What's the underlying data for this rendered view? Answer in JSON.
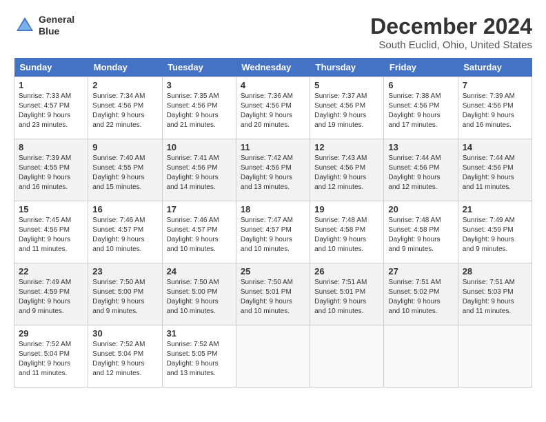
{
  "logo": {
    "line1": "General",
    "line2": "Blue"
  },
  "title": "December 2024",
  "subtitle": "South Euclid, Ohio, United States",
  "days_header": [
    "Sunday",
    "Monday",
    "Tuesday",
    "Wednesday",
    "Thursday",
    "Friday",
    "Saturday"
  ],
  "weeks": [
    [
      {
        "day": "1",
        "sunrise": "7:33 AM",
        "sunset": "4:57 PM",
        "daylight": "9 hours and 23 minutes."
      },
      {
        "day": "2",
        "sunrise": "7:34 AM",
        "sunset": "4:56 PM",
        "daylight": "9 hours and 22 minutes."
      },
      {
        "day": "3",
        "sunrise": "7:35 AM",
        "sunset": "4:56 PM",
        "daylight": "9 hours and 21 minutes."
      },
      {
        "day": "4",
        "sunrise": "7:36 AM",
        "sunset": "4:56 PM",
        "daylight": "9 hours and 20 minutes."
      },
      {
        "day": "5",
        "sunrise": "7:37 AM",
        "sunset": "4:56 PM",
        "daylight": "9 hours and 19 minutes."
      },
      {
        "day": "6",
        "sunrise": "7:38 AM",
        "sunset": "4:56 PM",
        "daylight": "9 hours and 17 minutes."
      },
      {
        "day": "7",
        "sunrise": "7:39 AM",
        "sunset": "4:56 PM",
        "daylight": "9 hours and 16 minutes."
      }
    ],
    [
      {
        "day": "8",
        "sunrise": "7:39 AM",
        "sunset": "4:55 PM",
        "daylight": "9 hours and 16 minutes."
      },
      {
        "day": "9",
        "sunrise": "7:40 AM",
        "sunset": "4:55 PM",
        "daylight": "9 hours and 15 minutes."
      },
      {
        "day": "10",
        "sunrise": "7:41 AM",
        "sunset": "4:56 PM",
        "daylight": "9 hours and 14 minutes."
      },
      {
        "day": "11",
        "sunrise": "7:42 AM",
        "sunset": "4:56 PM",
        "daylight": "9 hours and 13 minutes."
      },
      {
        "day": "12",
        "sunrise": "7:43 AM",
        "sunset": "4:56 PM",
        "daylight": "9 hours and 12 minutes."
      },
      {
        "day": "13",
        "sunrise": "7:44 AM",
        "sunset": "4:56 PM",
        "daylight": "9 hours and 12 minutes."
      },
      {
        "day": "14",
        "sunrise": "7:44 AM",
        "sunset": "4:56 PM",
        "daylight": "9 hours and 11 minutes."
      }
    ],
    [
      {
        "day": "15",
        "sunrise": "7:45 AM",
        "sunset": "4:56 PM",
        "daylight": "9 hours and 11 minutes."
      },
      {
        "day": "16",
        "sunrise": "7:46 AM",
        "sunset": "4:57 PM",
        "daylight": "9 hours and 10 minutes."
      },
      {
        "day": "17",
        "sunrise": "7:46 AM",
        "sunset": "4:57 PM",
        "daylight": "9 hours and 10 minutes."
      },
      {
        "day": "18",
        "sunrise": "7:47 AM",
        "sunset": "4:57 PM",
        "daylight": "9 hours and 10 minutes."
      },
      {
        "day": "19",
        "sunrise": "7:48 AM",
        "sunset": "4:58 PM",
        "daylight": "9 hours and 10 minutes."
      },
      {
        "day": "20",
        "sunrise": "7:48 AM",
        "sunset": "4:58 PM",
        "daylight": "9 hours and 9 minutes."
      },
      {
        "day": "21",
        "sunrise": "7:49 AM",
        "sunset": "4:59 PM",
        "daylight": "9 hours and 9 minutes."
      }
    ],
    [
      {
        "day": "22",
        "sunrise": "7:49 AM",
        "sunset": "4:59 PM",
        "daylight": "9 hours and 9 minutes."
      },
      {
        "day": "23",
        "sunrise": "7:50 AM",
        "sunset": "5:00 PM",
        "daylight": "9 hours and 9 minutes."
      },
      {
        "day": "24",
        "sunrise": "7:50 AM",
        "sunset": "5:00 PM",
        "daylight": "9 hours and 10 minutes."
      },
      {
        "day": "25",
        "sunrise": "7:50 AM",
        "sunset": "5:01 PM",
        "daylight": "9 hours and 10 minutes."
      },
      {
        "day": "26",
        "sunrise": "7:51 AM",
        "sunset": "5:01 PM",
        "daylight": "9 hours and 10 minutes."
      },
      {
        "day": "27",
        "sunrise": "7:51 AM",
        "sunset": "5:02 PM",
        "daylight": "9 hours and 10 minutes."
      },
      {
        "day": "28",
        "sunrise": "7:51 AM",
        "sunset": "5:03 PM",
        "daylight": "9 hours and 11 minutes."
      }
    ],
    [
      {
        "day": "29",
        "sunrise": "7:52 AM",
        "sunset": "5:04 PM",
        "daylight": "9 hours and 11 minutes."
      },
      {
        "day": "30",
        "sunrise": "7:52 AM",
        "sunset": "5:04 PM",
        "daylight": "9 hours and 12 minutes."
      },
      {
        "day": "31",
        "sunrise": "7:52 AM",
        "sunset": "5:05 PM",
        "daylight": "9 hours and 13 minutes."
      },
      null,
      null,
      null,
      null
    ]
  ]
}
